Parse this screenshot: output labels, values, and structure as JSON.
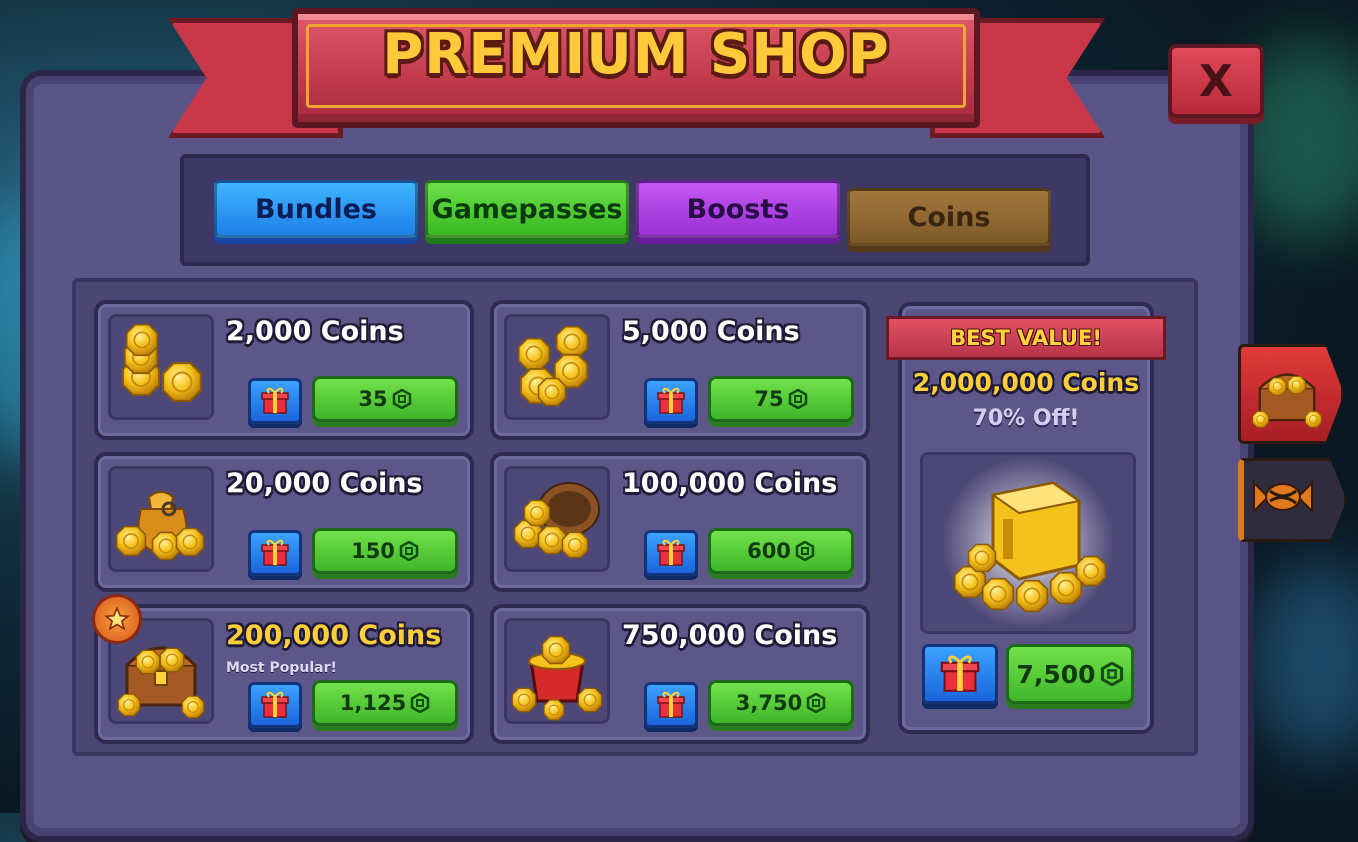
{
  "header": {
    "title": "PREMIUM SHOP",
    "close_label": "X"
  },
  "tabs": [
    {
      "label": "Bundles",
      "color": "#1f7fe8"
    },
    {
      "label": "Gamepasses",
      "color": "#38b824"
    },
    {
      "label": "Boosts",
      "color": "#9a30d6"
    },
    {
      "label": "Coins",
      "color": "#7e5a29",
      "active": true
    }
  ],
  "products": [
    {
      "name": "2,000 Coins",
      "price": "35",
      "icon": "coin-stack-icon"
    },
    {
      "name": "5,000 Coins",
      "price": "75",
      "icon": "coin-pile-icon"
    },
    {
      "name": "20,000 Coins",
      "price": "150",
      "icon": "coin-sack-icon"
    },
    {
      "name": "100,000 Coins",
      "price": "600",
      "icon": "coin-barrel-icon"
    },
    {
      "name": "200,000 Coins",
      "subtitle": "Most Popular!",
      "price": "1,125",
      "icon": "treasure-chest-icon"
    },
    {
      "name": "750,000 Coins",
      "price": "3,750",
      "icon": "coin-pot-icon"
    }
  ],
  "best_value": {
    "banner": "BEST VALUE!",
    "name": "2,000,000 Coins",
    "discount": "70% Off!",
    "price": "7,500",
    "icon": "gold-vault-icon"
  },
  "side_tabs": [
    {
      "icon": "treasure-chest-icon",
      "active": true
    },
    {
      "icon": "candy-icon",
      "active": false
    }
  ],
  "colors": {
    "accent_gold": "#ffcf3b",
    "price_green": "#3fb52a",
    "gift_blue": "#1a66db",
    "ribbon_red": "#c13a4d"
  }
}
